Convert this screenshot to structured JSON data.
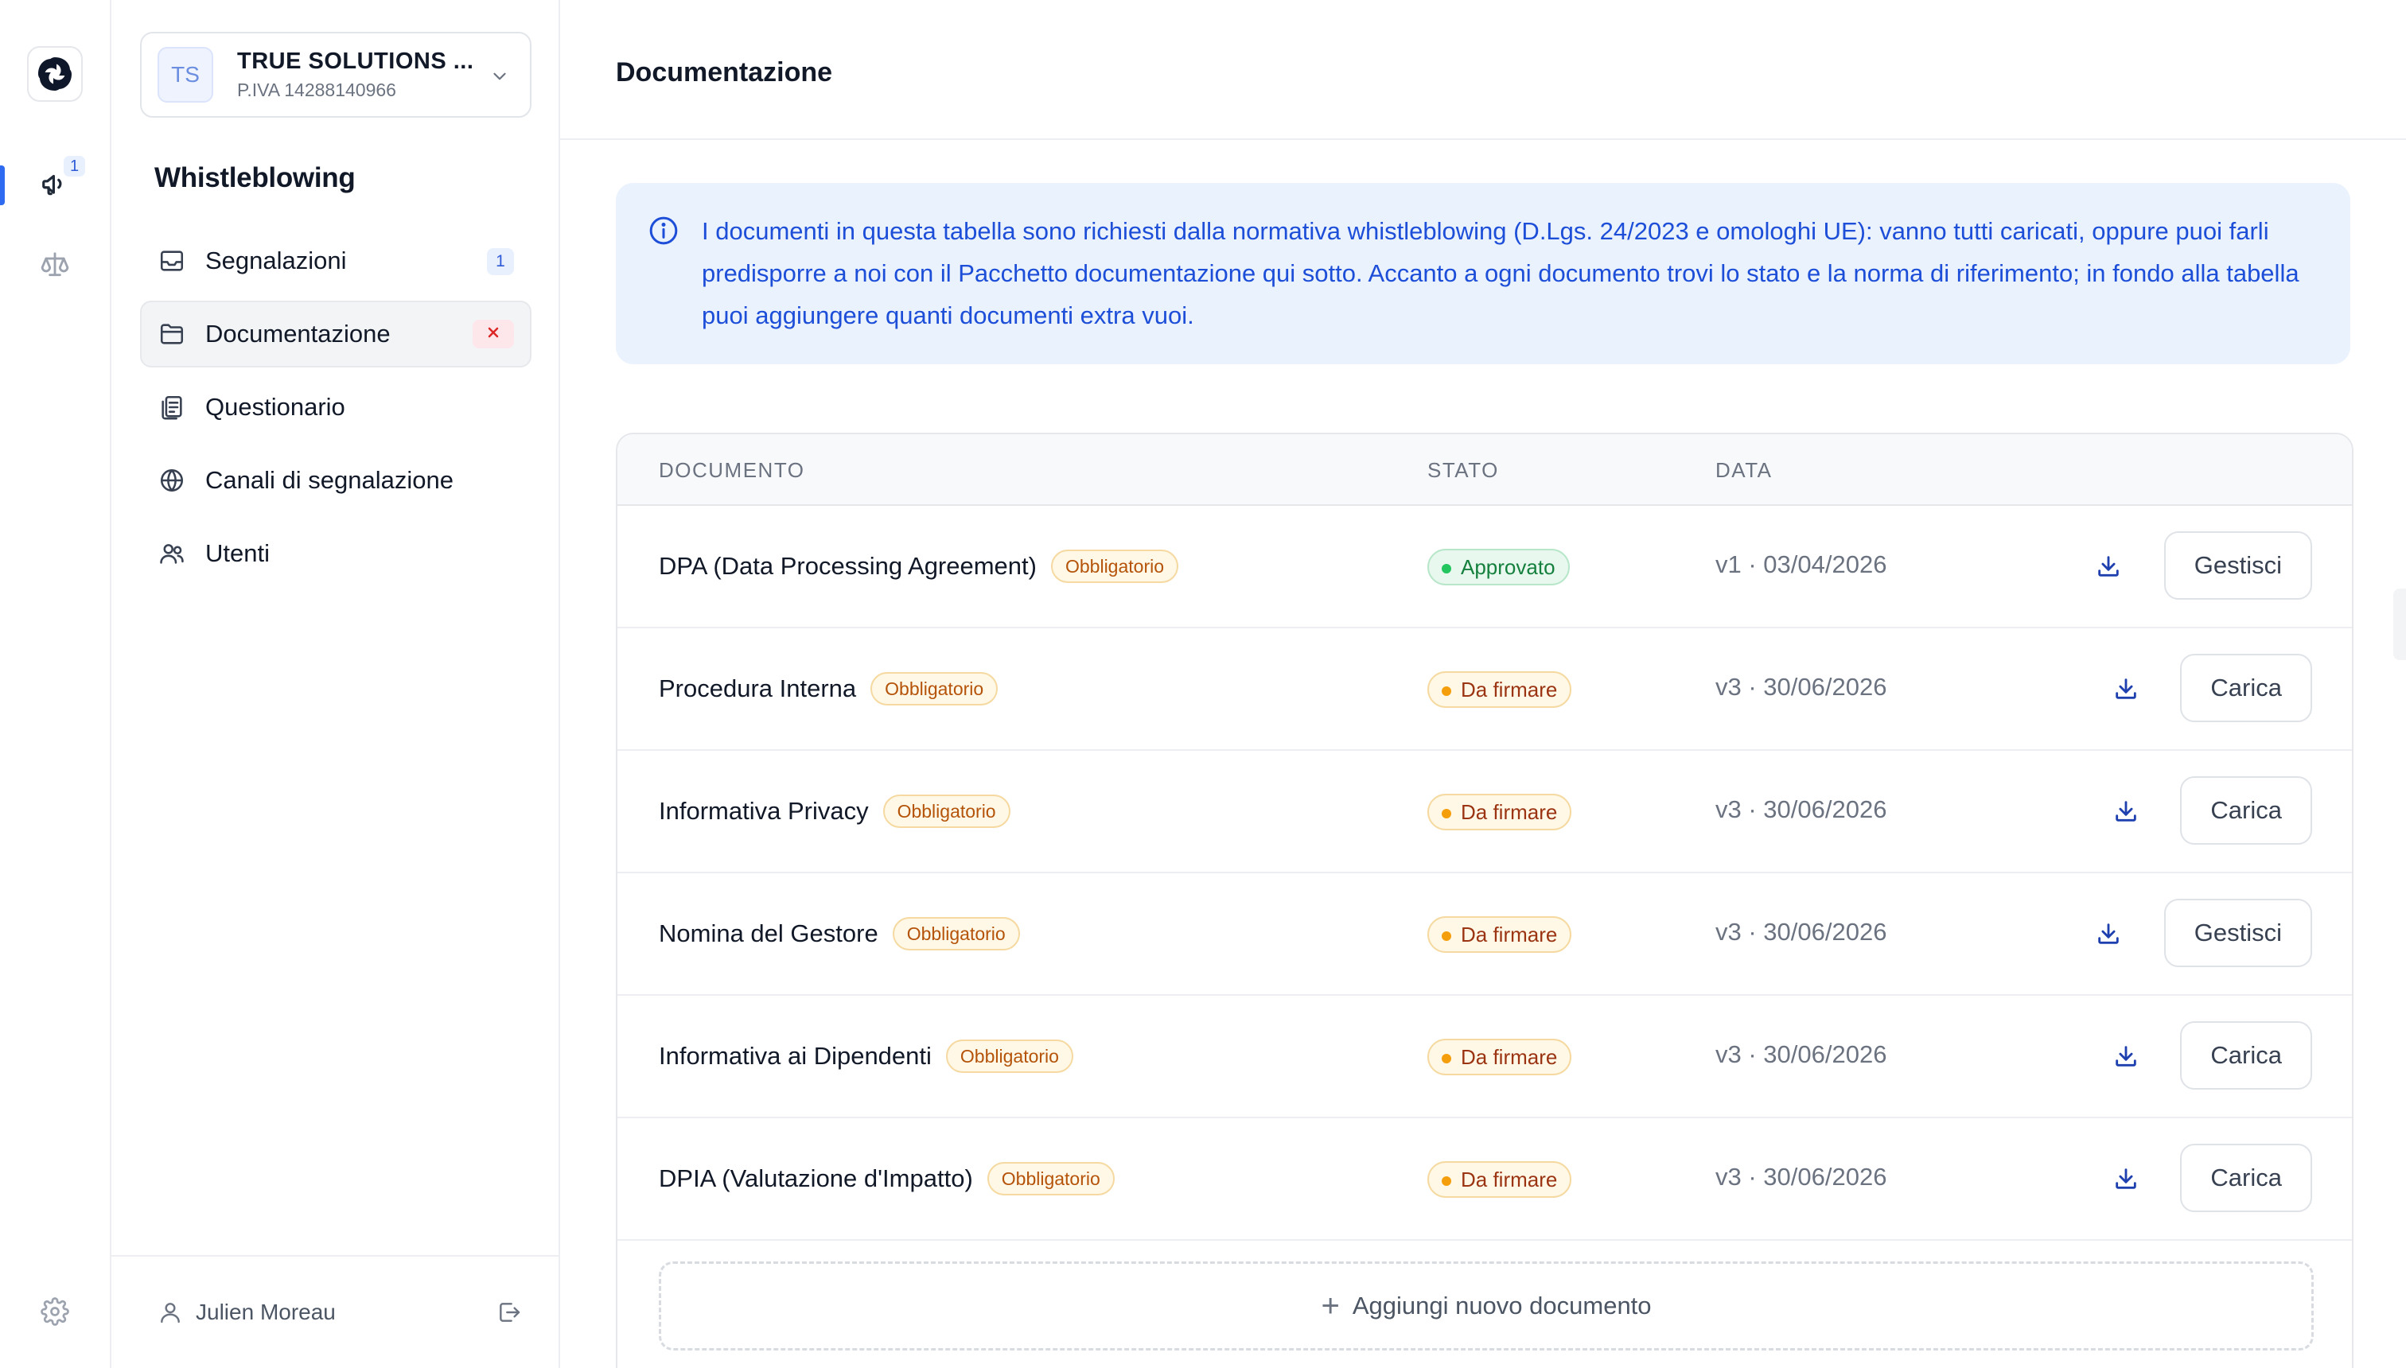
{
  "rail": {
    "notifications_badge": "1",
    "icons": [
      "logo-icon",
      "megaphone-icon",
      "scale-icon",
      "gear-icon"
    ]
  },
  "org": {
    "initials": "TS",
    "name": "TRUE SOLUTIONS ...",
    "vat": "P.IVA 14288140966"
  },
  "sidebar": {
    "section_title": "Whistleblowing",
    "items": [
      {
        "label": "Segnalazioni",
        "badge": "1",
        "icon": "inbox-icon"
      },
      {
        "label": "Documentazione",
        "status": "error",
        "icon": "folder-icon",
        "active": true
      },
      {
        "label": "Questionario",
        "icon": "clipboard-icon"
      },
      {
        "label": "Canali di segnalazione",
        "icon": "globe-icon"
      },
      {
        "label": "Utenti",
        "icon": "users-icon"
      }
    ],
    "user_name": "Julien Moreau"
  },
  "main": {
    "title": "Documentazione",
    "info_text": "I documenti in questa tabella sono richiesti dalla normativa whistleblowing (D.Lgs. 24/2023 e omologhi UE): vanno tutti caricati, oppure puoi farli predisporre a noi con il Pacchetto documentazione qui sotto. Accanto a ogni documento trovi lo stato e la norma di riferimento; in fondo alla tabella puoi aggiungere quanti documenti extra vuoi.",
    "table": {
      "columns": [
        "DOCUMENTO",
        "STATO",
        "DATA"
      ],
      "rows": [
        {
          "name": "DPA (Data Processing Agreement)",
          "tag": "Obbligatorio",
          "status": "Approvato",
          "date": "v1 · 03/04/2026",
          "action": "Gestisci"
        },
        {
          "name": "Procedura Interna",
          "tag": "Obbligatorio",
          "status": "Da firmare",
          "date": "v3 · 30/06/2026",
          "action": "Carica"
        },
        {
          "name": "Informativa Privacy",
          "tag": "Obbligatorio",
          "status": "Da firmare",
          "date": "v3 · 30/06/2026",
          "action": "Carica"
        },
        {
          "name": "Nomina del Gestore",
          "tag": "Obbligatorio",
          "status": "Da firmare",
          "date": "v3 · 30/06/2026",
          "action": "Gestisci"
        },
        {
          "name": "Informativa ai Dipendenti",
          "tag": "Obbligatorio",
          "status": "Da firmare",
          "date": "v3 · 30/06/2026",
          "action": "Carica"
        },
        {
          "name": "DPIA (Valutazione d'Impatto)",
          "tag": "Obbligatorio",
          "status": "Da firmare",
          "date": "v3 · 30/06/2026",
          "action": "Carica"
        }
      ],
      "add_label": "Aggiungi nuovo documento"
    }
  },
  "colors": {
    "accent": "#2f6bf0",
    "info_bg": "#eaf2fe",
    "info_text": "#1d4ed8",
    "approved": "#15803d",
    "pending": "#f59e0b",
    "required_tag": "#b45309",
    "error": "#dc2626"
  }
}
